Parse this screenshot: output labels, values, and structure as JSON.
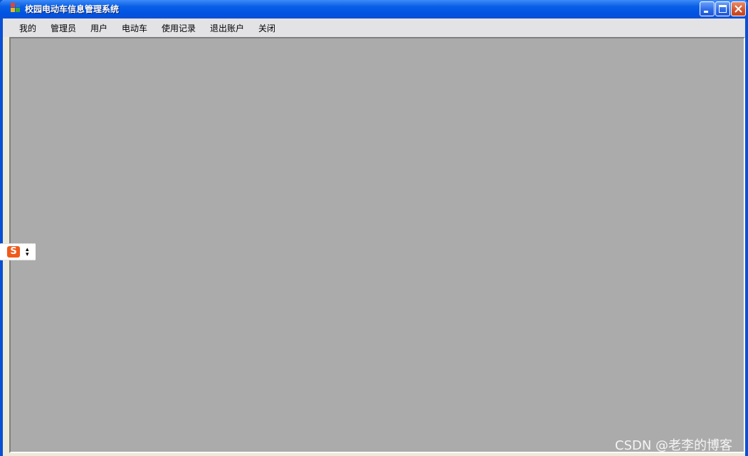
{
  "window": {
    "title": "校园电动车信息管理系统"
  },
  "controls": {
    "minimize": "minimize-icon",
    "maximize": "maximize-icon",
    "close": "close-icon"
  },
  "menu": [
    {
      "label": "我的"
    },
    {
      "label": "管理员"
    },
    {
      "label": "用户"
    },
    {
      "label": "电动车"
    },
    {
      "label": "使用记录"
    },
    {
      "label": "退出账户"
    },
    {
      "label": "关闭"
    }
  ],
  "ime": {
    "logo": "S",
    "icon": "sogou-ime-icon"
  },
  "watermark": "CSDN @老李的博客",
  "colors": {
    "titlebar": "#0054e3",
    "client_bg": "#ababab",
    "menubar": "#e3e3e6"
  }
}
